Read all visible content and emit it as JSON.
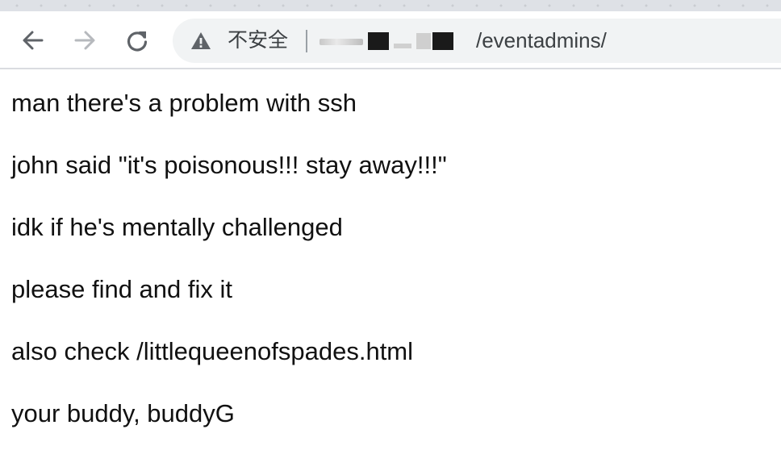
{
  "browser": {
    "security_label": "不安全",
    "url_path": "/eventadmins/",
    "icons": {
      "back": "arrow-left-icon",
      "forward": "arrow-right-icon",
      "reload": "reload-icon",
      "security": "warning-triangle-icon"
    },
    "colors": {
      "tab_strip": "#dee1e6",
      "omnibox": "#f1f3f4",
      "icon": "#5f6368",
      "icon_disabled": "#b6b9bd"
    }
  },
  "page": {
    "lines": [
      "man there's a problem with ssh",
      "john said \"it's poisonous!!! stay away!!!\"",
      "idk if he's mentally challenged",
      "please find and fix it",
      "also check /littlequeenofspades.html",
      "your buddy, buddyG"
    ]
  }
}
